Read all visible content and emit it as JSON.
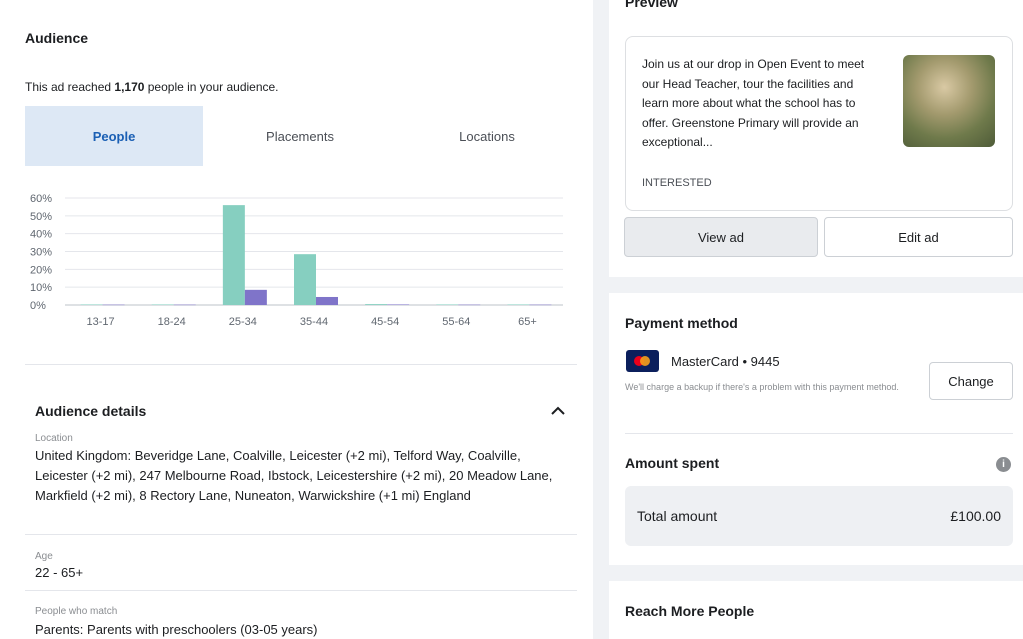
{
  "audience": {
    "title": "Audience",
    "reach_prefix": "This ad reached ",
    "reach_count": "1,170",
    "reach_suffix": " people in your audience.",
    "tabs": [
      "People",
      "Placements",
      "Locations"
    ],
    "active_tab": "People"
  },
  "chart_data": {
    "type": "bar",
    "categories": [
      "13-17",
      "18-24",
      "25-34",
      "35-44",
      "45-54",
      "55-64",
      "65+"
    ],
    "y_ticks": [
      "60%",
      "50%",
      "40%",
      "30%",
      "20%",
      "10%",
      "0%"
    ],
    "ylim": [
      0,
      60
    ],
    "series": [
      {
        "color": "#86cfc0",
        "values": [
          0.3,
          0.3,
          56,
          28.5,
          0.5,
          0.3,
          0.3
        ]
      },
      {
        "color": "#7f74c9",
        "values": [
          0.2,
          0.2,
          8.5,
          4.5,
          0.3,
          0.2,
          0.2
        ]
      }
    ]
  },
  "details": {
    "title": "Audience details",
    "location_label": "Location",
    "location_value": "United Kingdom: Beveridge Lane, Coalville, Leicester (+2 mi), Telford Way, Coalville, Leicester (+2 mi), 247 Melbourne Road, Ibstock, Leicestershire (+2 mi), 20 Meadow Lane, Markfield (+2 mi), 8 Rectory Lane, Nuneaton, Warwickshire (+1 mi) England",
    "age_label": "Age",
    "age_value": "22 - 65+",
    "match_label": "People who match",
    "match_value": "Parents: Parents with preschoolers (03-05 years)"
  },
  "preview": {
    "title": "Preview",
    "body": "Join us at our drop in Open Event to meet our Head Teacher, tour the facilities and learn more about what the school has to offer. Greenstone Primary will provide an exceptional...",
    "cta": "INTERESTED",
    "view_label": "View ad",
    "edit_label": "Edit ad"
  },
  "payment": {
    "title": "Payment method",
    "card": "MasterCard • 9445",
    "note": "We'll charge a backup if there's a problem with this payment method.",
    "change_label": "Change"
  },
  "spent": {
    "title": "Amount spent",
    "total_label": "Total amount",
    "total_value": "£100.00"
  },
  "reach_more": {
    "title": "Reach More People"
  }
}
